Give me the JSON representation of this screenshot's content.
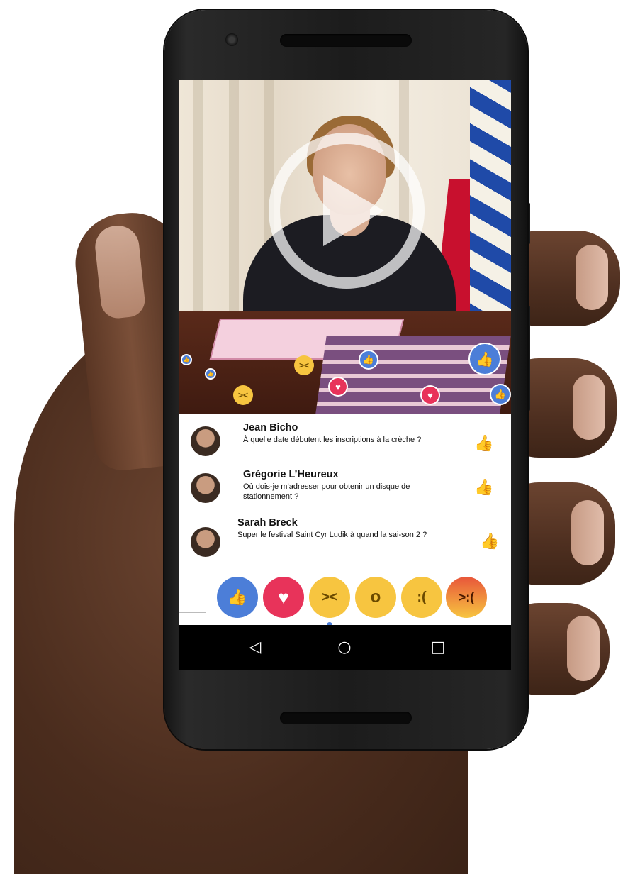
{
  "reactions_overlay": {
    "like_icon": "thumbs-up-icon",
    "heart_icon": "heart-icon",
    "haha_icon": "laughing-face-icon"
  },
  "video": {
    "play_icon": "play-icon"
  },
  "comments": [
    {
      "name": "Jean Bicho",
      "text": "À quelle date débutent les inscriptions à la crèche ?"
    },
    {
      "name": "Grégorie L’Heureux",
      "text": "Où dois-je m’adresser pour obtenir un disque de stationnement ?"
    },
    {
      "name": "Sarah Breck",
      "text": "Super le festival Saint Cyr Ludik à quand la sai-son 2 ?"
    }
  ],
  "reaction_bar": [
    {
      "name": "like",
      "icon": "thumbs-up-icon",
      "color": "#4c7ed8"
    },
    {
      "name": "love",
      "icon": "heart-icon",
      "color": "#e8335a"
    },
    {
      "name": "haha",
      "icon": "laughing-face-icon",
      "color": "#f7c540"
    },
    {
      "name": "wow",
      "icon": "surprised-face-icon",
      "color": "#f7c540"
    },
    {
      "name": "sad",
      "icon": "sad-face-icon",
      "color": "#f7c540"
    },
    {
      "name": "angry",
      "icon": "angry-face-icon",
      "color": "#e8563a"
    }
  ],
  "navbar": {
    "back_icon": "back-triangle-icon",
    "home_icon": "home-circle-icon",
    "recents_icon": "recents-square-icon"
  },
  "colors": {
    "fb_blue": "#4c7ed8",
    "fb_red": "#e8335a",
    "fb_yellow": "#f7c540"
  }
}
